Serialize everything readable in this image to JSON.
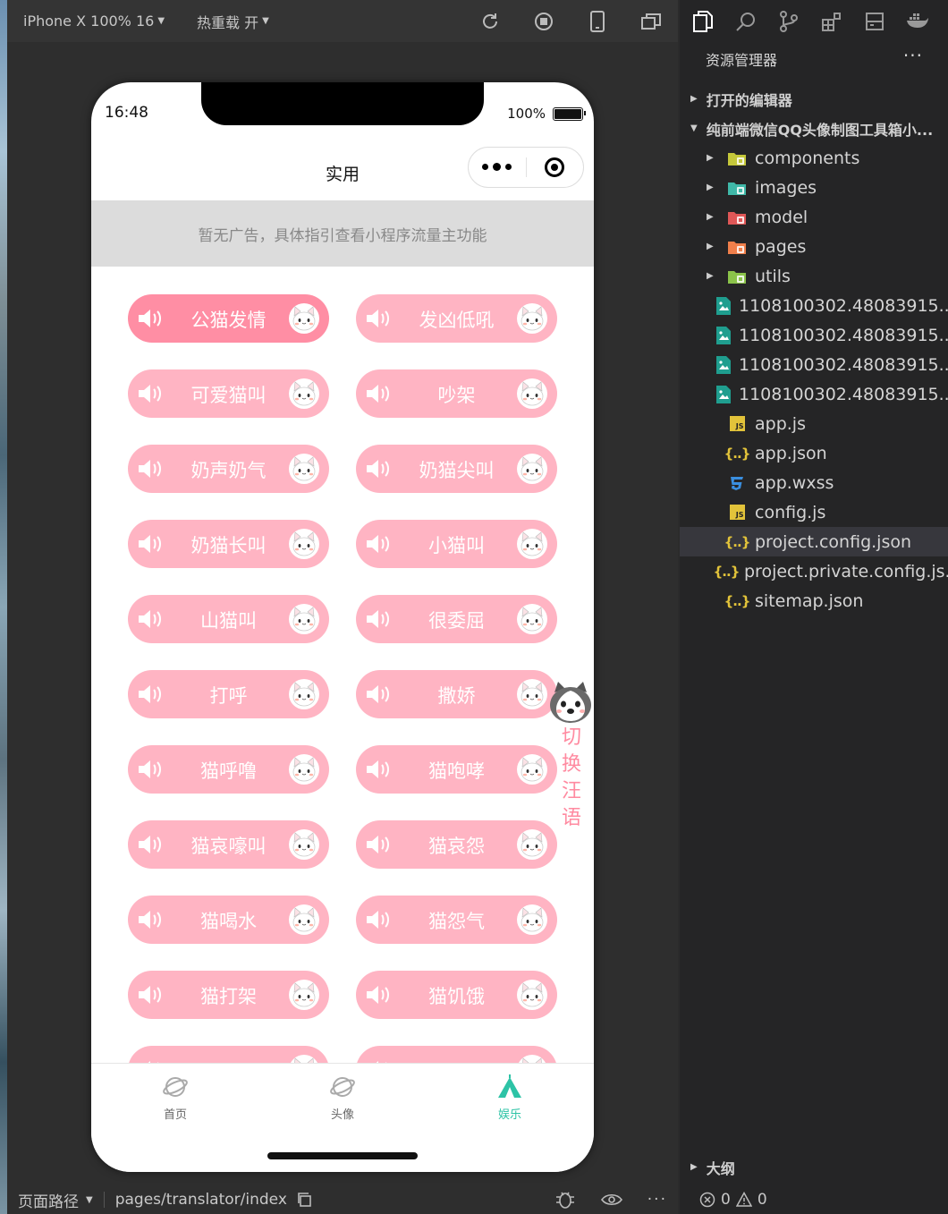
{
  "toolbar": {
    "device": "iPhone X 100% 16",
    "hotreload": "热重载 开"
  },
  "status": {
    "time": "16:48",
    "battery": "100%"
  },
  "nav": {
    "title": "实用"
  },
  "ad": {
    "text": "暂无广告，具体指引查看小程序流量主功能"
  },
  "sounds": [
    {
      "label": "公猫发情",
      "active": true
    },
    {
      "label": "发凶低吼"
    },
    {
      "label": "可爱猫叫"
    },
    {
      "label": "吵架"
    },
    {
      "label": "奶声奶气"
    },
    {
      "label": "奶猫尖叫"
    },
    {
      "label": "奶猫长叫"
    },
    {
      "label": "小猫叫"
    },
    {
      "label": "山猫叫"
    },
    {
      "label": "很委屈"
    },
    {
      "label": "打呼"
    },
    {
      "label": "撒娇"
    },
    {
      "label": "猫呼噜"
    },
    {
      "label": "猫咆哮"
    },
    {
      "label": "猫哀嚎叫"
    },
    {
      "label": "猫哀怨"
    },
    {
      "label": "猫喝水"
    },
    {
      "label": "猫怨气"
    },
    {
      "label": "猫打架"
    },
    {
      "label": "猫饥饿"
    }
  ],
  "float": {
    "line1": "切",
    "line2": "换",
    "line3": "汪",
    "line4": "语"
  },
  "tabs": [
    {
      "label": "首页",
      "icon": "planet-icon"
    },
    {
      "label": "头像",
      "icon": "planet-icon"
    },
    {
      "label": "娱乐",
      "icon": "tent-icon",
      "active": true
    }
  ],
  "bottom": {
    "path_label": "页面路径",
    "path": "pages/translator/index"
  },
  "explorer": {
    "title": "资源管理器",
    "open_editors": "打开的编辑器",
    "project": "纯前端微信QQ头像制图工具箱小...",
    "items": [
      {
        "name": "components",
        "type": "folder",
        "color": "#c5c83a"
      },
      {
        "name": "images",
        "type": "folder",
        "color": "#3fb8a8"
      },
      {
        "name": "model",
        "type": "folder",
        "color": "#e05757"
      },
      {
        "name": "pages",
        "type": "folder",
        "color": "#f07f4b"
      },
      {
        "name": "utils",
        "type": "folder",
        "color": "#8bc34a"
      },
      {
        "name": "1108100302.48083915...",
        "type": "image"
      },
      {
        "name": "1108100302.48083915...",
        "type": "image"
      },
      {
        "name": "1108100302.48083915...",
        "type": "image"
      },
      {
        "name": "1108100302.48083915...",
        "type": "image"
      },
      {
        "name": "app.js",
        "type": "js"
      },
      {
        "name": "app.json",
        "type": "json"
      },
      {
        "name": "app.wxss",
        "type": "css"
      },
      {
        "name": "config.js",
        "type": "js"
      },
      {
        "name": "project.config.json",
        "type": "json",
        "selected": true
      },
      {
        "name": "project.private.config.js...",
        "type": "json"
      },
      {
        "name": "sitemap.json",
        "type": "json"
      }
    ],
    "outline": "大纲",
    "errors": "0",
    "warnings": "0"
  }
}
